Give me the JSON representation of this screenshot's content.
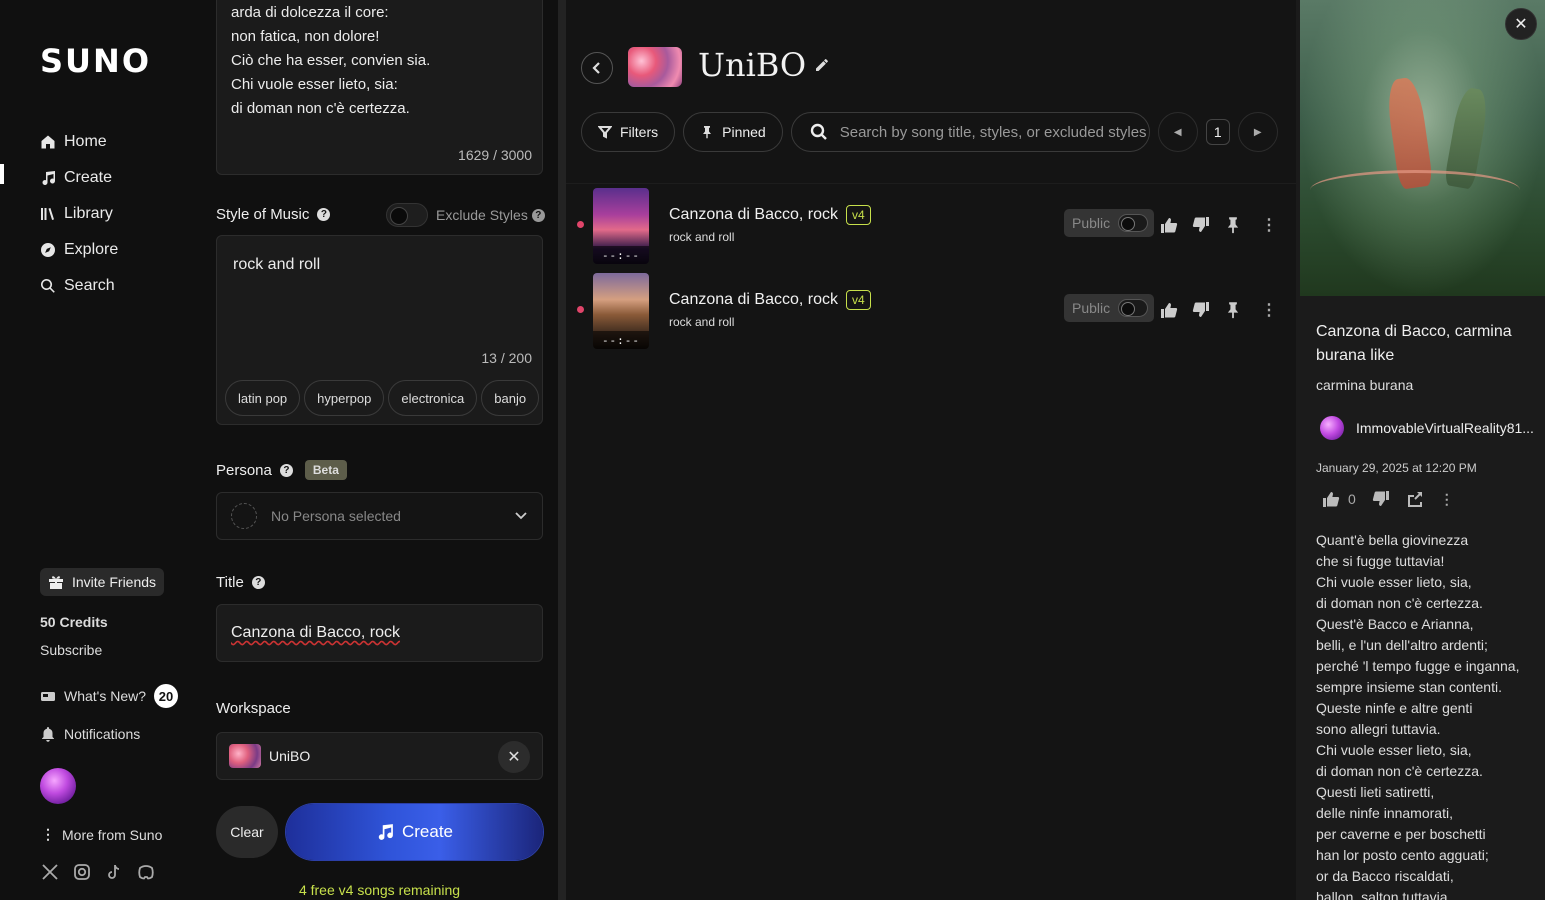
{
  "sidebar": {
    "logo": "SUNO",
    "nav": [
      {
        "label": "Home",
        "icon": "home-icon"
      },
      {
        "label": "Create",
        "icon": "music-note-icon"
      },
      {
        "label": "Library",
        "icon": "library-icon"
      },
      {
        "label": "Explore",
        "icon": "compass-icon"
      },
      {
        "label": "Search",
        "icon": "search-icon"
      }
    ],
    "active": "Create",
    "invite_label": "Invite Friends",
    "credits": "50 Credits",
    "subscribe": "Subscribe",
    "whats_new": "What's New?",
    "whats_new_count": "20",
    "notifications": "Notifications",
    "more_from": "More from Suno",
    "socials": [
      "x-icon",
      "instagram-icon",
      "tiktok-icon",
      "discord-icon"
    ]
  },
  "create": {
    "lyrics_lines": [
      "arda di dolcezza il core:",
      "non fatica, non dolore!",
      "Ciò che ha esser, convien sia.",
      "Chi vuole esser lieto, sia:",
      "di doman non c'è certezza."
    ],
    "lyrics_counter": "1629 / 3000",
    "style_label": "Style of Music",
    "exclude_label": "Exclude Styles",
    "style_value": "rock and roll",
    "style_counter": "13 / 200",
    "style_chips": [
      "latin pop",
      "hyperpop",
      "electronica",
      "banjo"
    ],
    "persona_label": "Persona",
    "persona_badge": "Beta",
    "persona_placeholder": "No Persona selected",
    "title_label": "Title",
    "title_value": "Canzona di Bacco, rock",
    "workspace_label": "Workspace",
    "workspace_value": "UniBO",
    "clear_label": "Clear",
    "create_label": "Create",
    "free_remaining": "4 free v4 songs remaining"
  },
  "workspace": {
    "title": "UniBO",
    "filters_label": "Filters",
    "pinned_label": "Pinned",
    "search_placeholder": "Search by song title, styles, or excluded styles",
    "page": "1",
    "songs": [
      {
        "title": "Canzona di Bacco, rock",
        "version": "v4",
        "style": "rock and roll",
        "duration": "--:--",
        "visibility": "Public"
      },
      {
        "title": "Canzona di Bacco, rock",
        "version": "v4",
        "style": "rock and roll",
        "duration": "--:--",
        "visibility": "Public"
      }
    ]
  },
  "details": {
    "title": "Canzona di Bacco, carmina burana like",
    "style": "carmina burana",
    "user": "ImmovableVirtualReality81...",
    "date": "January 29, 2025 at 12:20 PM",
    "likes": "0",
    "lyrics": [
      "Quant'è bella giovinezza",
      "che si fugge tuttavia!",
      "Chi vuole esser lieto, sia,",
      "di doman non c'è certezza.",
      "Quest'è Bacco e Arianna,",
      "belli, e l'un dell'altro ardenti;",
      "perché 'l tempo fugge e inganna,",
      "sempre insieme stan contenti.",
      "Queste ninfe e altre genti",
      "sono allegri tuttavia.",
      "Chi vuole esser lieto, sia,",
      "di doman non c'è certezza.",
      "Questi lieti satiretti,",
      "delle ninfe innamorati,",
      "per caverne e per boschetti",
      "han lor posto cento agguati;",
      "or da Bacco riscaldati,",
      "ballon, salton tuttavia."
    ]
  }
}
